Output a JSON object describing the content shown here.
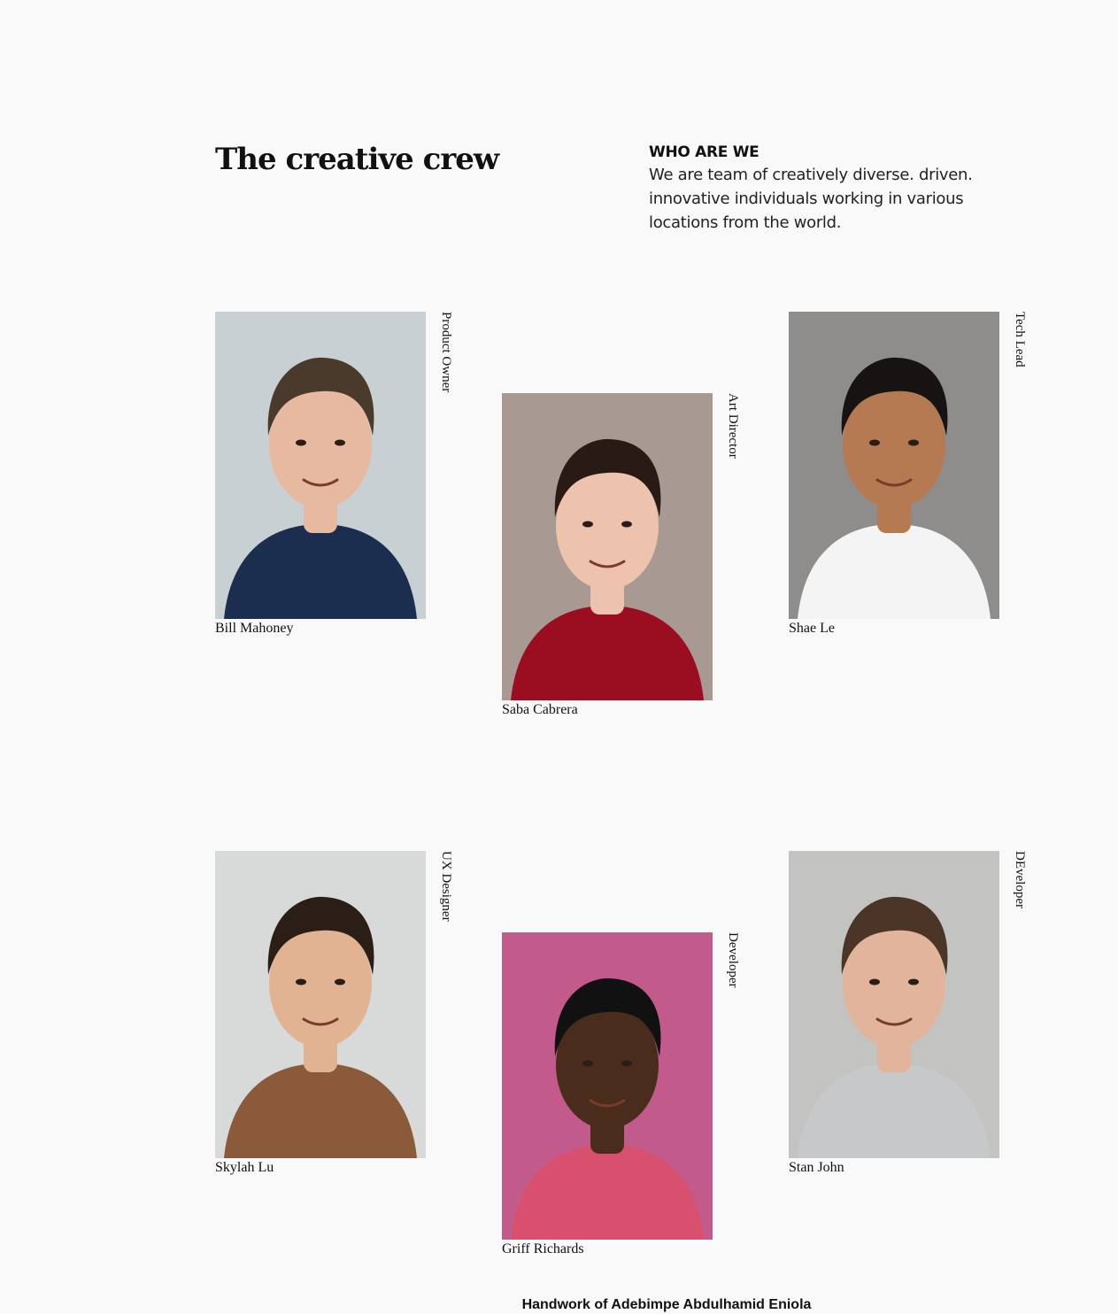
{
  "header": {
    "title": "The creative crew",
    "about_heading": "WHO ARE WE",
    "about_text": "We are team of creatively diverse. driven. innovative individuals working in various locations from the world."
  },
  "members": [
    {
      "name": "Bill Mahoney",
      "role": "Product Owner",
      "bg": "#c9d0d3",
      "skin": "#e6b9a0",
      "hair": "#4a3a2c",
      "shirt": "#1c2e4f"
    },
    {
      "name": "Saba Cabrera",
      "role": "Art Director",
      "bg": "#a89a93",
      "skin": "#eec3ad",
      "hair": "#2a1a16",
      "shirt": "#9b0e22"
    },
    {
      "name": "Shae Le",
      "role": "Tech Lead",
      "bg": "#8f8d8b",
      "skin": "#b57a52",
      "hair": "#171312",
      "shirt": "#f4f4f4"
    },
    {
      "name": "Skylah Lu",
      "role": "UX Designer",
      "bg": "#d8d9d9",
      "skin": "#e2b393",
      "hair": "#2b1e16",
      "shirt": "#8a5a3a"
    },
    {
      "name": "Griff Richards",
      "role": "Developer",
      "bg": "#c35a8c",
      "skin": "#4a2c1c",
      "hair": "#111111",
      "shirt": "#d9506e"
    },
    {
      "name": "Stan John",
      "role": "DEveloper",
      "bg": "#c3c3c1",
      "skin": "#e1b49b",
      "hair": "#4a3526",
      "shirt": "#c7c8c9"
    }
  ],
  "footer": {
    "credit": "Handwork of Adebimpe Abdulhamid Eniola"
  }
}
